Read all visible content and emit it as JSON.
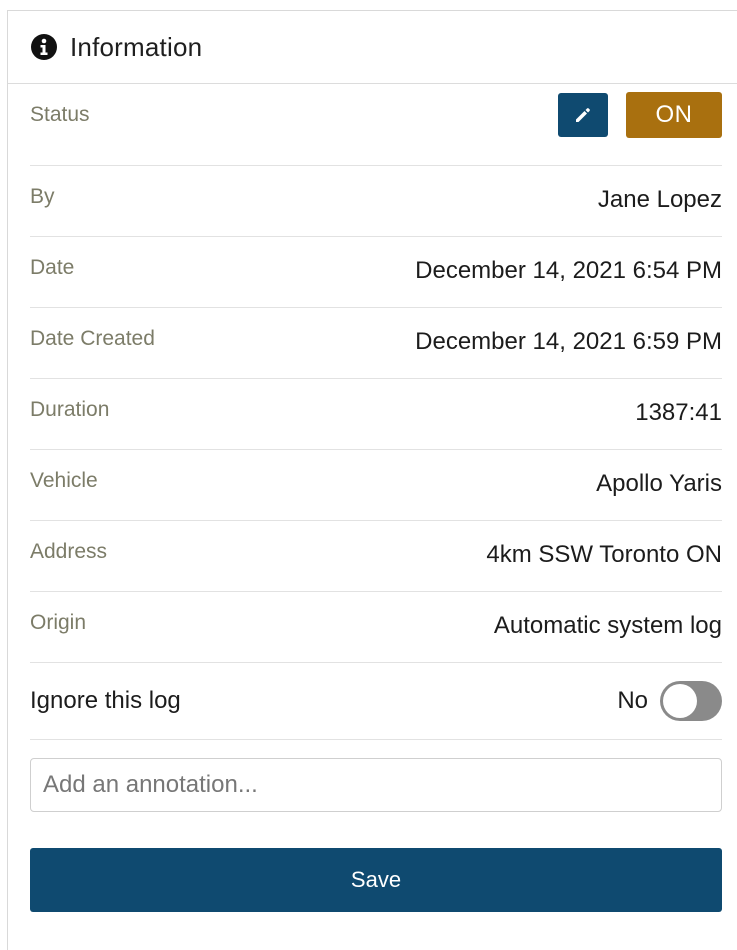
{
  "header": {
    "title": "Information",
    "icon": "info-circle-icon"
  },
  "status": {
    "label": "Status",
    "edit_icon": "pencil-icon",
    "badge": "ON",
    "badge_color": "#a9700f",
    "edit_color": "#0f4a70"
  },
  "fields": {
    "by": {
      "label": "By",
      "value": "Jane Lopez"
    },
    "date": {
      "label": "Date",
      "value": "December 14, 2021 6:54 PM"
    },
    "date_created": {
      "label": "Date Created",
      "value": "December 14, 2021 6:59 PM"
    },
    "duration": {
      "label": "Duration",
      "value": "1387:41"
    },
    "vehicle": {
      "label": "Vehicle",
      "value": "Apollo Yaris"
    },
    "address": {
      "label": "Address",
      "value": "4km SSW Toronto ON"
    },
    "origin": {
      "label": "Origin",
      "value": "Automatic system log"
    }
  },
  "ignore": {
    "label": "Ignore this log",
    "value": "No",
    "enabled": false
  },
  "annotation": {
    "placeholder": "Add an annotation...",
    "value": ""
  },
  "save": {
    "label": "Save",
    "color": "#0f4a70"
  }
}
